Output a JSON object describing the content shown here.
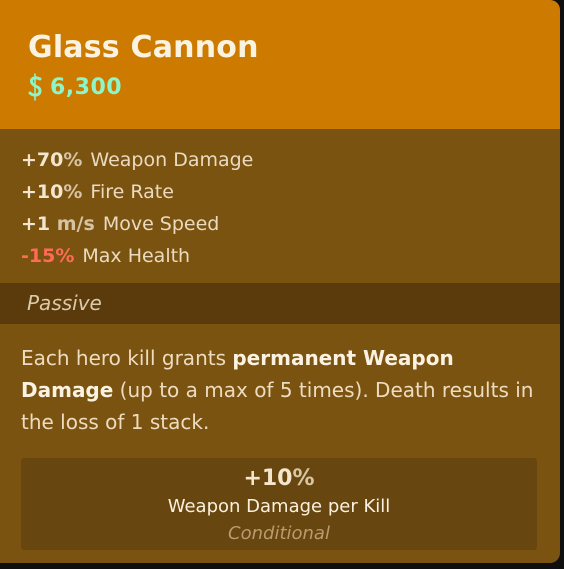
{
  "item": {
    "name": "Glass Cannon",
    "cost": "6,300",
    "currency_icon": "souls-currency-icon",
    "colors": {
      "header": "#cc7a00",
      "body": "#7a5310",
      "cost": "#8ef5c9",
      "negative": "#ff6b57"
    }
  },
  "stats": [
    {
      "amount": "+70",
      "unit": "%",
      "label": "Weapon Damage",
      "negative": false
    },
    {
      "amount": "+10",
      "unit": "%",
      "label": "Fire Rate",
      "negative": false
    },
    {
      "amount": "+1",
      "unit": " m/s",
      "label": "Move Speed",
      "negative": false
    },
    {
      "amount": "-15",
      "unit": "%",
      "label": "Max Health",
      "negative": true
    }
  ],
  "passive": {
    "heading": "Passive",
    "desc_pre": "Each hero kill grants ",
    "desc_bold": "permanent Weapon Damage",
    "desc_post": " (up to a max of 5 times). Death results in the loss of 1 stack.",
    "bonus_amount": "+10",
    "bonus_unit": "%",
    "bonus_label": "Weapon Damage per Kill",
    "bonus_condition": "Conditional"
  }
}
